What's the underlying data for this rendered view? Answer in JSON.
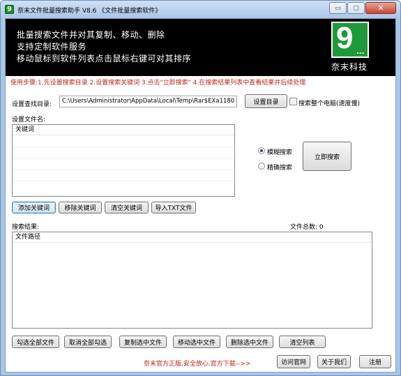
{
  "window": {
    "title": "奈末文件批量搜索助手 V8.6  《文件批量搜索软件》",
    "app_icon": "9",
    "controls": {
      "minimize": "▭",
      "maximize": "▢",
      "close": "✕"
    }
  },
  "banner": {
    "lines": [
      "批量搜索文件并对其复制、移动、删除",
      "支持定制软件服务",
      "移动鼠标到软件列表点击鼠标右键可对其排序"
    ],
    "logo_digit": "9",
    "logo_dots": "...",
    "company": "奈末科技"
  },
  "steps_text": "使用步骤:1.先设置搜索目录 2.设置搜索关键词 3.点击\"立即搜索\" 4.在搜索结果列表中查看结果并后续处理",
  "search_dir": {
    "label": "设置查找目录:",
    "value": "C:\\Users\\Administrator\\AppData\\Local\\Temp\\Rar$EXa1180",
    "button": "设置目录",
    "whole_pc_label": "搜索整个电脑(速度慢)"
  },
  "keywords": {
    "label": "设置文件名:",
    "column_header": "关键词"
  },
  "match_mode": {
    "fuzzy": "模糊搜索",
    "exact": "精确搜索",
    "selected": "fuzzy"
  },
  "search_button": "立即搜索",
  "keyword_buttons": {
    "add": "添加关键词",
    "remove": "移除关键词",
    "clear": "清空关键词",
    "import_txt": "导入TXT文件"
  },
  "results": {
    "label": "搜索结果:",
    "count_label": "文件总数: 0",
    "column_header": "文件路径"
  },
  "result_buttons": {
    "select_all": "勾选全部文件",
    "deselect_all": "取消全部勾选",
    "copy": "复制选中文件",
    "move": "移动选中文件",
    "delete": "删除选中文件",
    "clear_list": "清空列表"
  },
  "footer": {
    "note": "奈末官方正版,安全放心,官方下载-->>",
    "visit_site": "访问官网",
    "about": "关于我们",
    "register": "注册"
  },
  "colors": {
    "accent_red": "#c0261b",
    "banner_bg": "#000000",
    "logo_green": "#1f9a3a"
  }
}
